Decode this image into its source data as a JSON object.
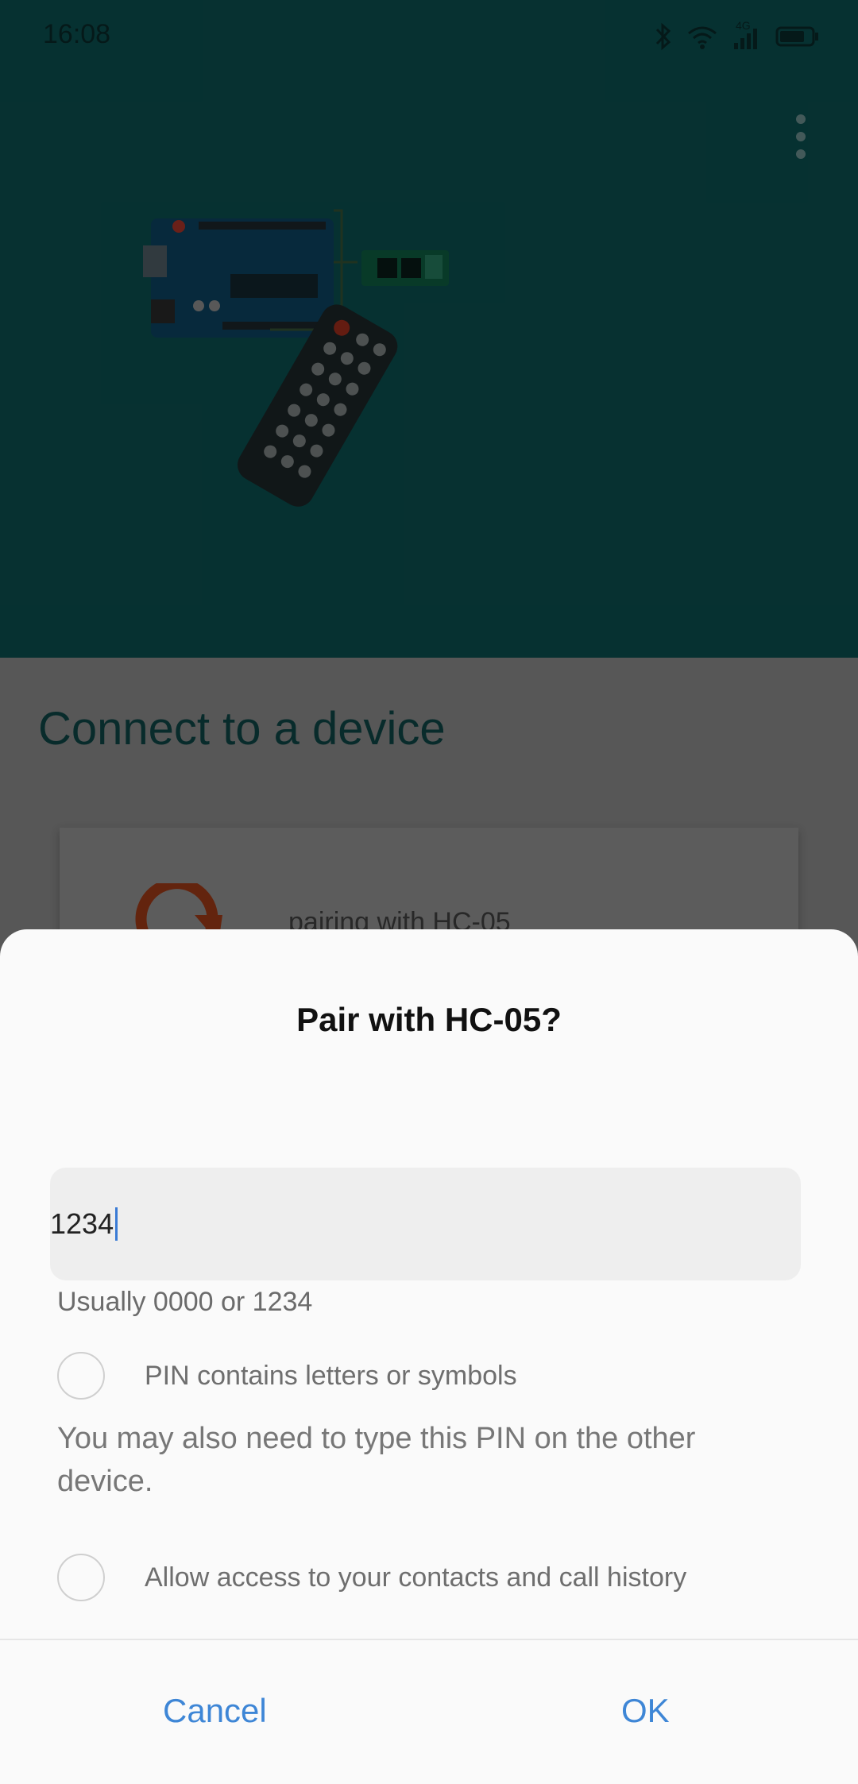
{
  "status_bar": {
    "time": "16:08",
    "icons": [
      "bluetooth-icon",
      "wifi-icon",
      "signal-4g-icon",
      "battery-icon"
    ],
    "network_label": "4G"
  },
  "app": {
    "menu_icon": "more-vert-icon",
    "section_title": "Connect to a device",
    "device_status": "pairing with HC-05"
  },
  "dialog": {
    "title": "Pair with HC-05?",
    "pin_value": "1234",
    "helper": "Usually 0000 or 1234",
    "option_letters": "PIN contains letters or symbols",
    "info": "You may also need to type this PIN on the other device.",
    "option_contacts": "Allow access to your contacts and call history",
    "cancel_label": "Cancel",
    "ok_label": "OK"
  },
  "colors": {
    "hero": "#0c5a5a",
    "accent": "#3e86d6",
    "title": "#0f4f4f"
  }
}
